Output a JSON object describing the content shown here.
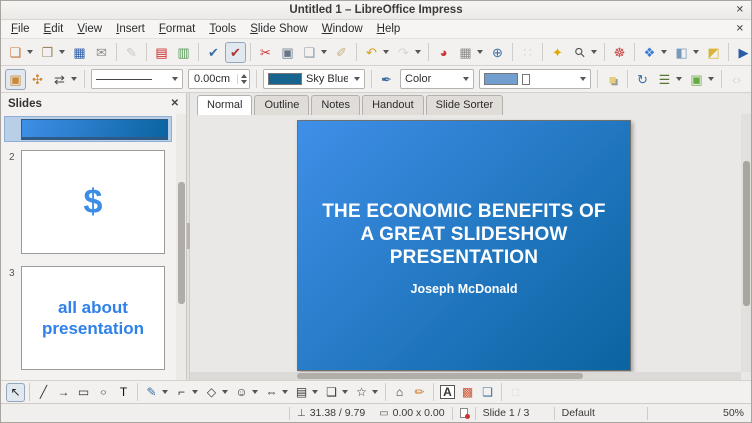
{
  "window": {
    "title": "Untitled 1 – LibreOffice Impress",
    "close_glyph": "✕"
  },
  "menubar": {
    "items": [
      "File",
      "Edit",
      "View",
      "Insert",
      "Format",
      "Tools",
      "Slide Show",
      "Window",
      "Help"
    ],
    "close_glyph": "✕"
  },
  "toolbar_main": [
    {
      "n": "new-document-icon",
      "g": "❏",
      "c": "#c87137",
      "d": true
    },
    {
      "n": "open-folder-icon",
      "g": "❒",
      "c": "#9a8866",
      "d": true
    },
    {
      "n": "save-icon",
      "g": "▦",
      "c": "#2a5da8"
    },
    {
      "n": "email-icon",
      "g": "✉",
      "c": "#8a8a8a"
    },
    {
      "sep": true
    },
    {
      "n": "edit-mode-icon",
      "g": "✎",
      "c": "#888888",
      "dis": true
    },
    {
      "sep": true
    },
    {
      "n": "export-pdf-icon",
      "g": "▤",
      "c": "#cc2222"
    },
    {
      "n": "print-icon",
      "g": "▥",
      "c": "#559955"
    },
    {
      "sep": true
    },
    {
      "n": "spellcheck-icon",
      "g": "✔",
      "c": "#3a6ea5"
    },
    {
      "n": "auto-spellcheck-icon",
      "g": "✔",
      "c": "#aa3333",
      "a": true
    },
    {
      "sep": true
    },
    {
      "n": "cut-icon",
      "g": "✂",
      "c": "#cc3333"
    },
    {
      "n": "copy-icon",
      "g": "▣",
      "c": "#667788"
    },
    {
      "n": "paste-icon",
      "g": "❑",
      "c": "#8899aa",
      "d": true
    },
    {
      "n": "clone-formatting-icon",
      "g": "✐",
      "c": "#c9b37e"
    },
    {
      "sep": true
    },
    {
      "n": "undo-icon",
      "g": "↶",
      "c": "#d4a017",
      "d": true
    },
    {
      "n": "redo-icon",
      "g": "↷",
      "c": "#aaaaaa",
      "d": true,
      "dis": true
    },
    {
      "sep": true
    },
    {
      "n": "insert-chart-icon",
      "g": "◕",
      "c": "#cc3333"
    },
    {
      "n": "insert-table-icon",
      "g": "▦",
      "c": "#8a8a8a",
      "d": true
    },
    {
      "n": "hyperlink-icon",
      "g": "⊕",
      "c": "#3a6ea5"
    },
    {
      "sep": true
    },
    {
      "n": "display-grid-icon",
      "g": "∷",
      "c": "#aaaaaa",
      "dis": true
    },
    {
      "sep": true
    },
    {
      "n": "navigator-icon",
      "g": "✦",
      "c": "#e0a800"
    },
    {
      "n": "zoom-icon",
      "g": "⚲",
      "c": "#555555",
      "d": true
    },
    {
      "sep": true
    },
    {
      "n": "help-icon",
      "g": "☸",
      "c": "#cc4444"
    },
    {
      "sep": true
    },
    {
      "n": "new-slide-icon",
      "g": "❖",
      "c": "#3a7ad9",
      "d": true
    },
    {
      "n": "slide-layout-icon",
      "g": "◧",
      "c": "#7799bb",
      "d": true
    },
    {
      "n": "master-slide-icon",
      "g": "◩",
      "c": "#d9b43a"
    },
    {
      "sep": true
    },
    {
      "n": "start-slideshow-icon",
      "g": "▶",
      "c": "#2a5da8"
    }
  ],
  "toolbar_line_left": [
    {
      "n": "edit-points-icon",
      "g": "▣",
      "c": "#cc8833",
      "a": true
    },
    {
      "n": "glue-points-icon",
      "g": "✣",
      "c": "#cc8833"
    },
    {
      "n": "arrow-style-icon",
      "g": "⇄",
      "c": "#444444",
      "d": true
    },
    {
      "sep": true
    }
  ],
  "toolbar_line_mid": [
    {
      "sep": true
    },
    {
      "n": "fill-style-icon",
      "g": "✒",
      "c": "#3a6ea5"
    }
  ],
  "toolbar_line_right": [
    {
      "n": "shadow-icon",
      "g": "■",
      "c": "#e6cf7a"
    },
    {
      "sep": true
    },
    {
      "n": "rotate-icon",
      "g": "↻",
      "c": "#3a6ea5"
    },
    {
      "n": "align-objects-icon",
      "g": "☰",
      "c": "#557733",
      "d": true
    },
    {
      "n": "arrange-objects-icon",
      "g": "▣",
      "c": "#66aa44",
      "d": true
    },
    {
      "sep": true
    },
    {
      "n": "angle-brackets-icon",
      "g": "‹›",
      "c": "#aaaaaa",
      "dis": true
    }
  ],
  "toolbar2": {
    "line_width": "0.00cm",
    "line_color_label": "Sky Blue",
    "line_color_hex": "#17648f",
    "fill_type_label": "Color",
    "fill_color_hex": "#729fcf"
  },
  "slides_panel": {
    "title": "Slides",
    "close_glyph": "✕",
    "slides": [
      {
        "num": "",
        "content": "",
        "selected": true
      },
      {
        "num": "2",
        "content": "$"
      },
      {
        "num": "3",
        "content": "all about presentation"
      }
    ],
    "dollar_color": "#3d8ce8",
    "text_color": "#2f80e8"
  },
  "view_tabs": [
    {
      "label": "Normal",
      "active": true
    },
    {
      "label": "Outline"
    },
    {
      "label": "Notes"
    },
    {
      "label": "Handout"
    },
    {
      "label": "Slide Sorter"
    }
  ],
  "slide": {
    "title": "THE ECONOMIC BENEFITS OF A GREAT SLIDESHOW PRESENTATION",
    "subtitle": "Joseph McDonald",
    "gradient_from": "#3f8fe8",
    "gradient_to": "#0a64a0"
  },
  "drawbar": [
    {
      "n": "select-icon",
      "g": "↖",
      "c": "#222222",
      "a": true
    },
    {
      "sep": true
    },
    {
      "n": "line-icon",
      "g": "╱",
      "c": "#333333"
    },
    {
      "n": "line-arrow-icon",
      "g": "→",
      "c": "#333333"
    },
    {
      "n": "rectangle-icon",
      "g": "▭",
      "c": "#333333"
    },
    {
      "n": "ellipse-icon",
      "g": "○",
      "c": "#333333"
    },
    {
      "n": "text-box-icon",
      "g": "T",
      "c": "#111111"
    },
    {
      "sep": true
    },
    {
      "n": "curve-icon",
      "g": "✎",
      "c": "#3a6ea5",
      "d": true
    },
    {
      "n": "connector-icon",
      "g": "⌐",
      "c": "#333333",
      "d": true
    },
    {
      "n": "basic-shapes-icon",
      "g": "◇",
      "c": "#333333",
      "d": true
    },
    {
      "n": "symbol-shapes-icon",
      "g": "☺",
      "c": "#333333",
      "d": true
    },
    {
      "n": "block-arrows-icon",
      "g": "⇔",
      "c": "#333333",
      "d": true
    },
    {
      "n": "flowchart-icon",
      "g": "▤",
      "c": "#333333",
      "d": true
    },
    {
      "n": "callout-shapes-icon",
      "g": "❑",
      "c": "#333333",
      "d": true
    },
    {
      "n": "star-shapes-icon",
      "g": "☆",
      "c": "#333333",
      "d": true
    },
    {
      "sep": true
    },
    {
      "n": "points-icon",
      "g": "⌂",
      "c": "#333333"
    },
    {
      "n": "glue-points-tool-icon",
      "g": "✏",
      "c": "#cc7722"
    },
    {
      "sep": true
    },
    {
      "n": "fontwork-icon",
      "g": "A",
      "c": "#333333"
    },
    {
      "n": "insert-image-icon",
      "g": "▩",
      "c": "#cc5533"
    },
    {
      "n": "gallery-icon",
      "g": "❏",
      "c": "#3a6ea5"
    },
    {
      "sep": true
    },
    {
      "n": "extrusion-icon",
      "g": "□",
      "c": "#bbbbbb",
      "dis": true
    }
  ],
  "statusbar": {
    "position_icon": "⊥",
    "position": "31.38 / 9.79",
    "size_icon": "▭",
    "size": "0.00 x 0.00",
    "slide": "Slide 1 / 3",
    "style": "Default",
    "zoom": "50%"
  }
}
